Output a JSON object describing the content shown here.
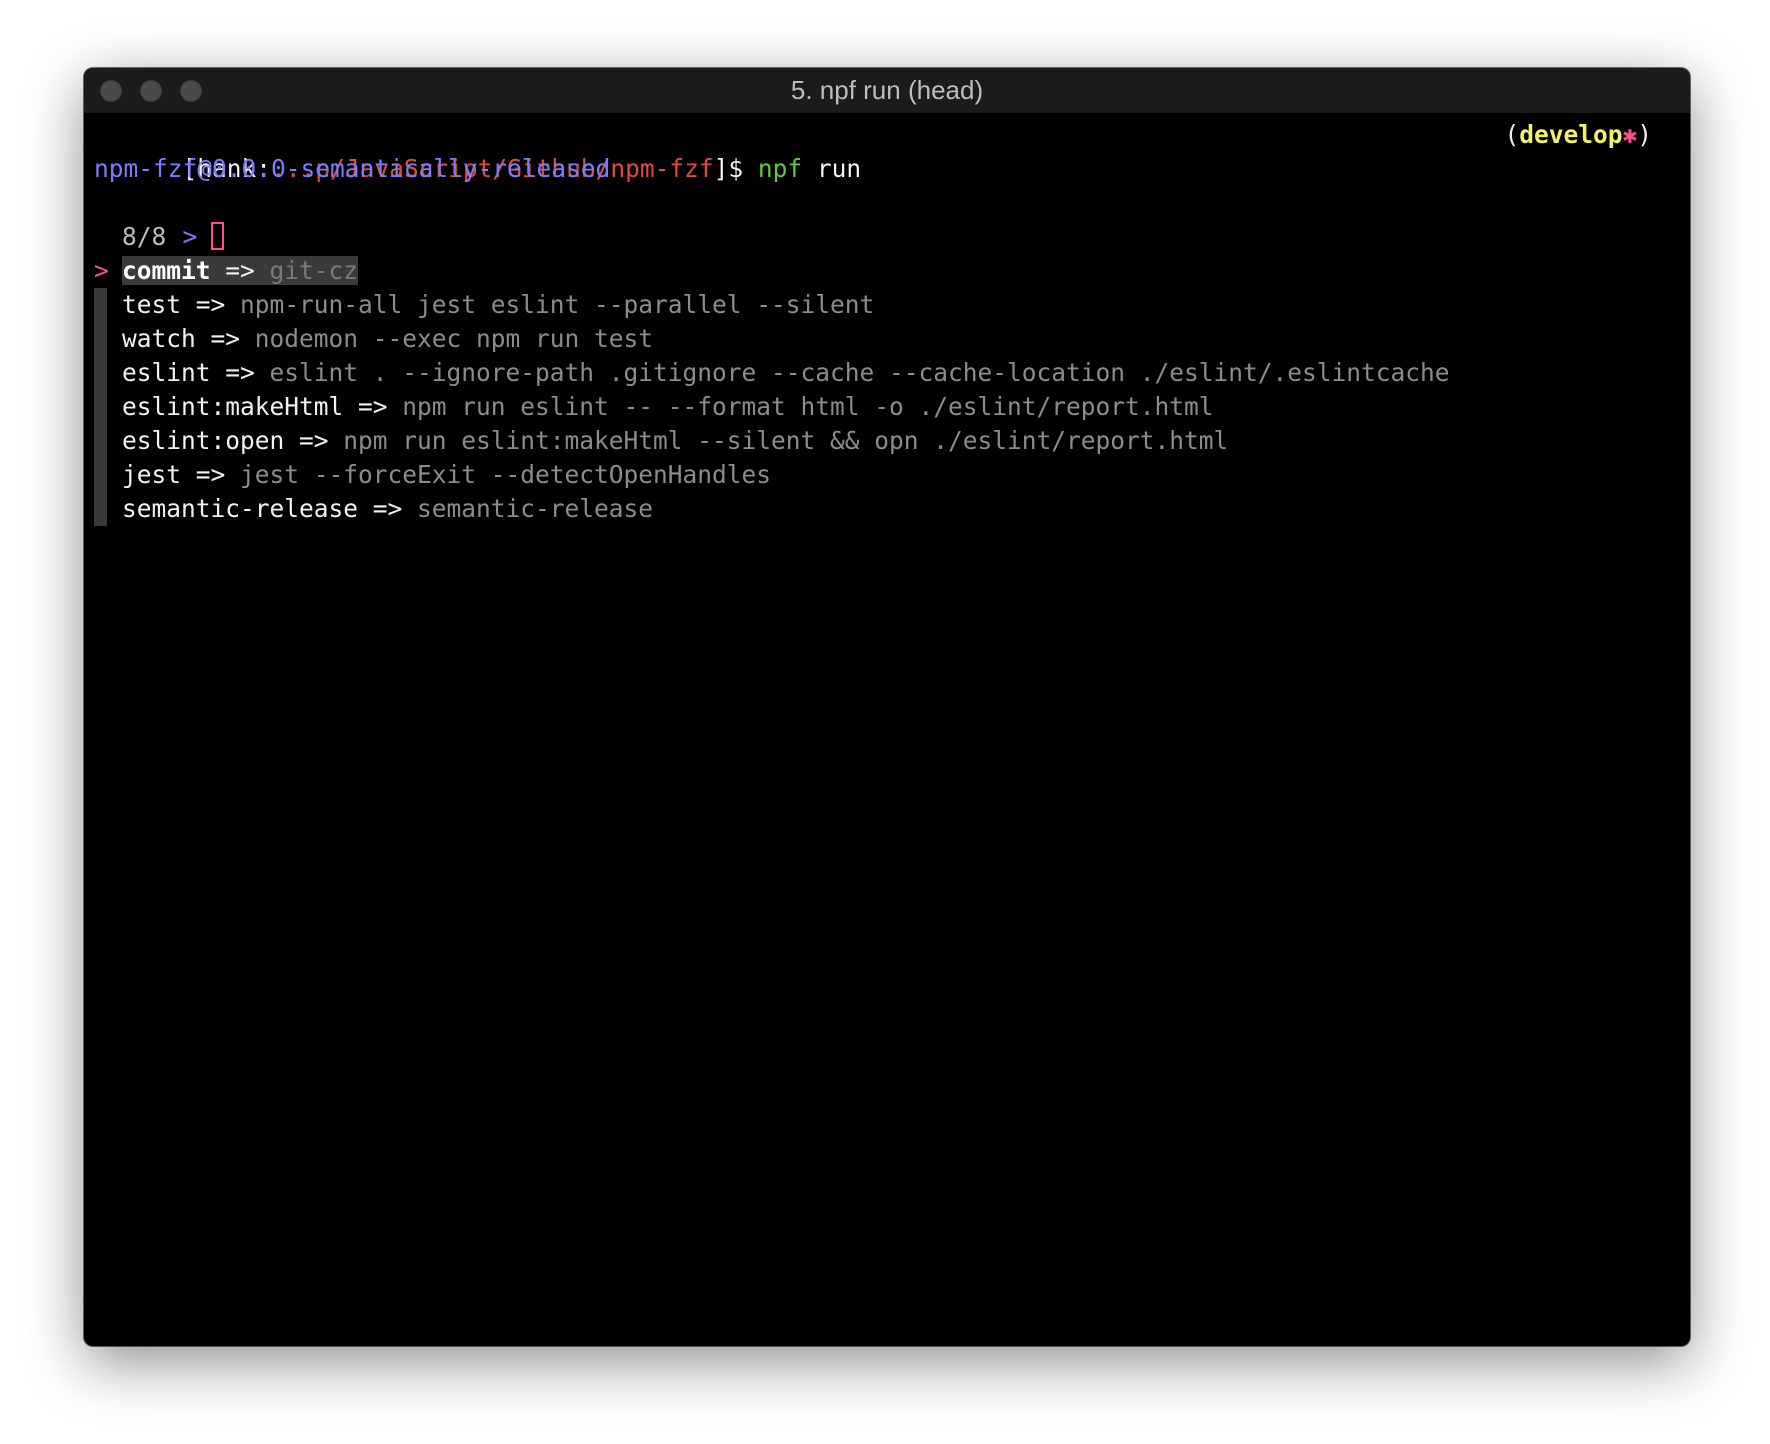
{
  "window": {
    "title": "5. npf run (head)"
  },
  "prompt": {
    "open_bracket": "[",
    "user": "hank",
    "colon": ":",
    "path": "...p/JavaScript/Github/npm-fzf",
    "close": "]$ ",
    "command": "npf",
    "args": " run",
    "branch_open": "(",
    "branch": "develop",
    "dirty_mark": "✱",
    "branch_close": ")"
  },
  "package_line": "npm-fzf@0.0.0-semantically-released",
  "finder": {
    "prompt_symbol": ">",
    "query": "",
    "count": "8/8",
    "pointer": ">",
    "arrow": "=>",
    "items": [
      {
        "name": "commit",
        "cmd": "git-cz",
        "selected": true
      },
      {
        "name": "test",
        "cmd": "npm-run-all jest eslint --parallel --silent"
      },
      {
        "name": "watch",
        "cmd": "nodemon --exec npm run test"
      },
      {
        "name": "eslint",
        "cmd": "eslint . --ignore-path .gitignore --cache --cache-location ./eslint/.eslintcache"
      },
      {
        "name": "eslint:makeHtml",
        "cmd": "npm run eslint -- --format html -o ./eslint/report.html"
      },
      {
        "name": "eslint:open",
        "cmd": "npm run eslint:makeHtml --silent && opn ./eslint/report.html"
      },
      {
        "name": "jest",
        "cmd": "jest --forceExit --detectOpenHandles"
      },
      {
        "name": "semantic-release",
        "cmd": "semantic-release"
      }
    ]
  },
  "colors": {
    "path": "#e24a36",
    "command": "#5ccb45",
    "package": "#7b7cff",
    "branch": "#f4f06a",
    "accent": "#ff4d8f",
    "selection_bg": "#3a3a3a"
  }
}
